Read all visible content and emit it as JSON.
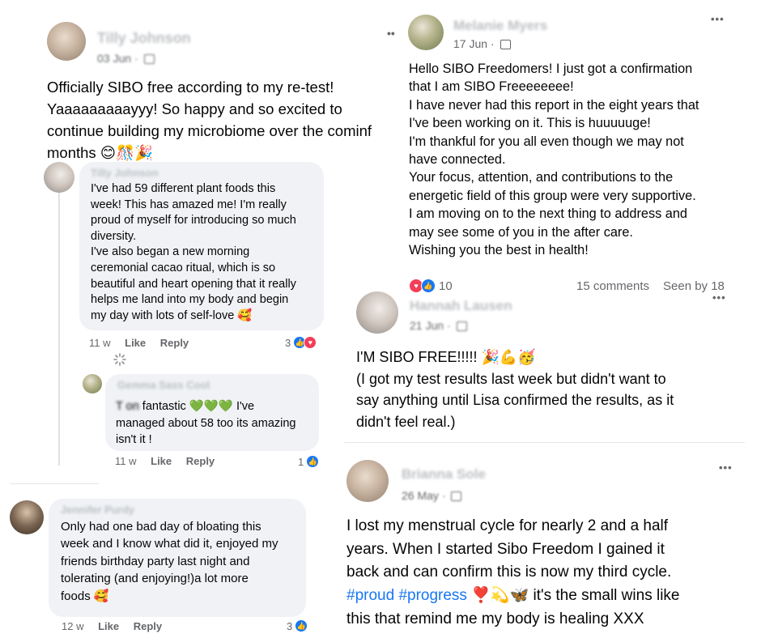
{
  "post_left": {
    "author": "Tilly Johnson",
    "date": "03 Jun",
    "text": "Officially SIBO free according to my re-test!\nYaaaaaaaaayyy! So happy and so excited to\ncontinue building my microbiome over the cominf\nmonths 😊🎊🎉"
  },
  "comment_1": {
    "author": "Tilly Johnson",
    "text": "I've had 59 different plant foods this\nweek! This has amazed me! I'm really\nproud of myself for introducing so much\ndiversity.\nI've also began a new morning\nceremonial cacao ritual, which is so\nbeautiful and heart opening that it really\nhelps me land into my body and begin\nmy day with lots of self-love 🥰",
    "time": "11 w",
    "like": "Like",
    "reply": "Reply",
    "reaction_count": "3"
  },
  "comment_2": {
    "author": "Gemma Sass Cool",
    "mention": "T                    on",
    "text_after": " fantastic 💚💚💚 I've\nmanaged about 58 too its amazing\nisn't it !",
    "time": "11 w",
    "like": "Like",
    "reply": "Reply",
    "reaction_count": "1"
  },
  "comment_3": {
    "author": "Jennifer Purdy",
    "text": "Only had one bad day of bloating this\nweek and I know what did it, enjoyed my\nfriends birthday party last night and\ntolerating (and enjoying!)a lot more\nfoods 🥰",
    "time": "12 w",
    "like": "Like",
    "reply": "Reply",
    "reaction_count": "3"
  },
  "post_right_1": {
    "author": "Melanie Myers",
    "date": "17 Jun",
    "text": "Hello SIBO Freedomers!  I just got a confirmation\nthat I am SIBO Freeeeeeee!\nI have never had this report in the eight years that\nI've been working on it.  This is huuuuuge!\nI'm thankful for you all even though we may not\nhave connected.\nYour focus, attention, and contributions to the\nenergetic field of this group were very supportive.\nI am moving on to the next thing to address and\nmay see some of you in the after care.\nWishing you the best in health!",
    "reaction_count": "10",
    "comments": "15 comments",
    "seen": "Seen by 18"
  },
  "post_right_2": {
    "author": "Hannah Lausen",
    "date": "21 Jun",
    "text": "I'M SIBO FREE!!!!! 🎉💪🥳\n(I got my test results last week but didn't want to\nsay anything until Lisa confirmed the results, as it\ndidn't feel real.)"
  },
  "post_right_3": {
    "author": "Brianna Sole",
    "date": "26 May",
    "text_line1": "I lost my menstrual cycle for nearly 2 and a half\nyears. When I started Sibo Freedom I gained it\nback and can confirm this is now my third cycle.",
    "hashtags": "#proud #progress",
    "text_line2": " ❣️💫🦋 it's the small wins like\nthis that remind me my body is healing XXX"
  },
  "ui": {
    "more_dots": "•••",
    "two_dots": "••",
    "separator": "·"
  },
  "colors": {
    "like_blue": "#1877f2",
    "heart_red": "#f33e58",
    "bubble_gray": "#f0f2f5",
    "meta_gray": "#65676b"
  },
  "icons": [
    "globe-icon",
    "like-reaction-icon",
    "love-reaction-icon",
    "more-options-icon",
    "loading-spinner-icon"
  ]
}
